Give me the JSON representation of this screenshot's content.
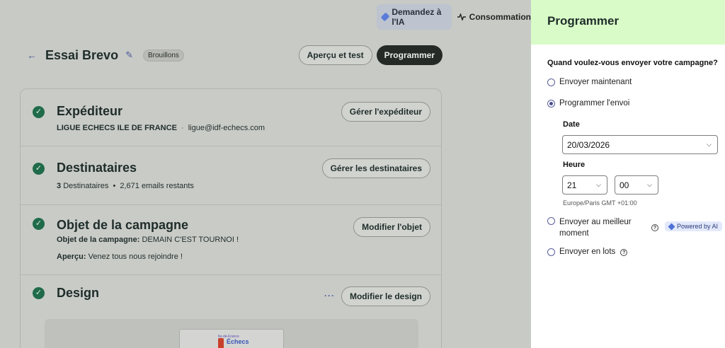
{
  "topbar": {
    "ai_label": "Demandez à l'IA",
    "conso_label": "Consommation"
  },
  "campaign": {
    "title": "Essai Brevo",
    "status_badge": "Brouillons",
    "preview_button": "Aperçu et test",
    "schedule_button": "Programmer"
  },
  "sections": {
    "sender": {
      "title": "Expéditeur",
      "name": "LIGUE ECHECS ILE DE FRANCE",
      "separator": "·",
      "email": "ligue@idf-echecs.com",
      "button": "Gérer l'expéditeur"
    },
    "recipients": {
      "title": "Destinataires",
      "count": "3",
      "count_label": "Destinataires",
      "separator": "•",
      "emails_left": "2,671 emails restants",
      "button": "Gérer les destinataires"
    },
    "subject": {
      "title": "Objet de la campagne",
      "subject_label": "Objet de la campagne:",
      "subject_value": "DEMAIN C'EST TOURNOI !",
      "preview_label": "Aperçu:",
      "preview_value": "Venez tous nous rejoindre !",
      "button": "Modifier l'objet"
    },
    "design": {
      "title": "Design",
      "more": "···",
      "button": "Modifier le design",
      "logo_small": "Ile-de-France",
      "logo_text": "Échecs"
    }
  },
  "panel": {
    "title": "Programmer",
    "question": "Quand voulez-vous envoyer votre campagne?",
    "options": {
      "now": "Envoyer maintenant",
      "schedule": "Programmer l'envoi",
      "best_time": "Envoyer au meilleur moment",
      "batches": "Envoyer en lots"
    },
    "selected_option": "schedule",
    "date_label": "Date",
    "date_value": "20/03/2026",
    "time_label": "Heure",
    "hour_value": "21",
    "minute_value": "00",
    "timezone": "Europe/Paris GMT +01:00",
    "powered_label": "Powered by AI"
  },
  "colors": {
    "panel_header": "#d9fbc8",
    "check_green": "#1f6b4a",
    "accent_blue": "#4e72d6",
    "dark_button": "#262a26"
  }
}
